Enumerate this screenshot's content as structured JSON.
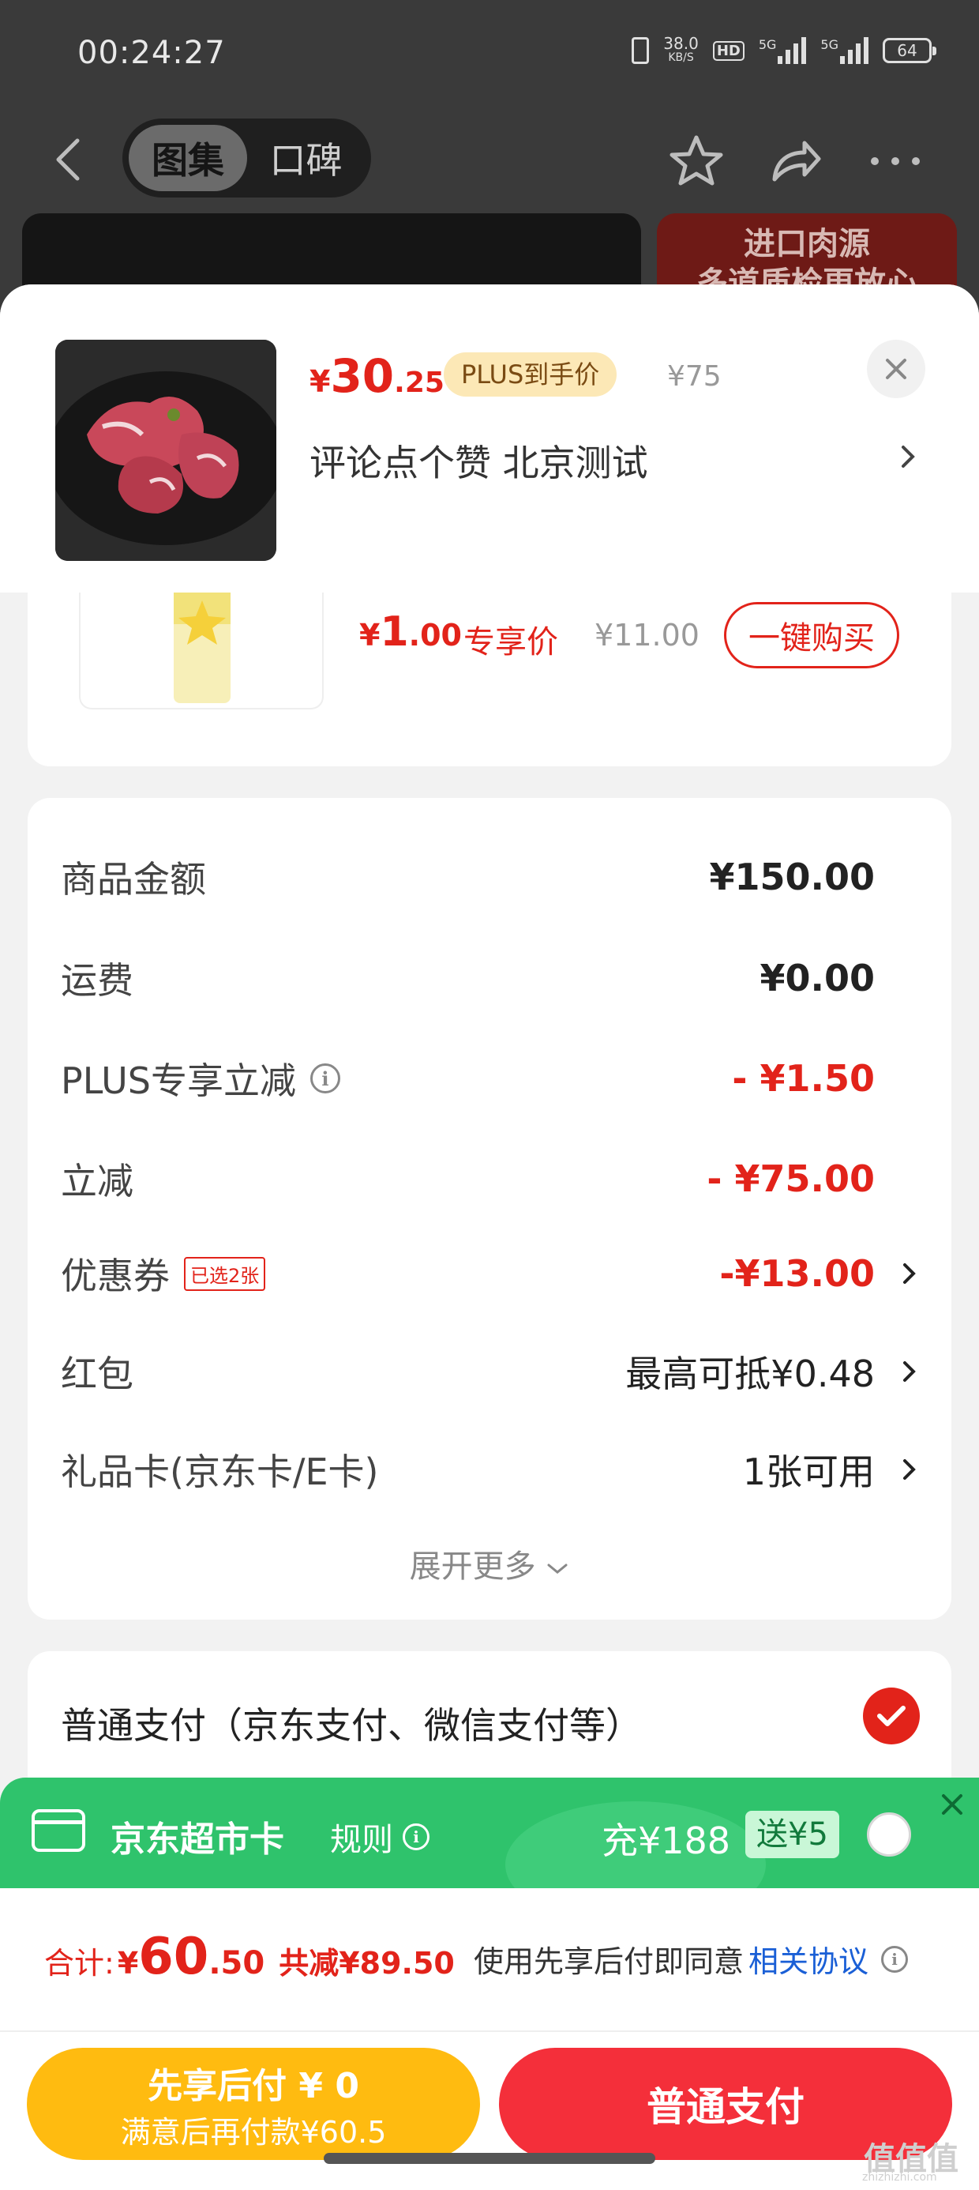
{
  "status_bar": {
    "time": "00:24:27",
    "net_speed": "38.0",
    "net_unit": "KB/S",
    "hd": "HD",
    "sig1_tag": "5G",
    "sig2_tag": "5G",
    "battery": "64"
  },
  "nav": {
    "tab_gallery": "图集",
    "tab_reviews": "口碑"
  },
  "hero": {
    "banner_text": "进口肉源\n多道质检更放心"
  },
  "product": {
    "price_currency": "¥",
    "price_int": "30",
    "price_dec": ".25",
    "plus_badge": "PLUS到手价",
    "original_price": "¥75",
    "title": "评论点个赞  北京测试"
  },
  "gift_item": {
    "price_currency": "¥",
    "price_int": "1",
    "price_dec": ".00",
    "tag": "专享价",
    "original_price": "¥11.00",
    "buy_label": "一键购买"
  },
  "summary": {
    "rows": [
      {
        "label": "商品金额",
        "value": "¥150.00"
      },
      {
        "label": "运费",
        "value": "¥0.00"
      },
      {
        "label": "PLUS专享立减",
        "value": "- ¥1.50"
      },
      {
        "label": "立减",
        "value": "- ¥75.00"
      },
      {
        "label": "优惠券",
        "badge": "已选2张",
        "value": "-¥13.00"
      },
      {
        "label": "红包",
        "value": "最高可抵¥0.48"
      },
      {
        "label": "礼品卡(京东卡/E卡)",
        "value": "1张可用"
      }
    ],
    "expand_label": "展开更多"
  },
  "payment": {
    "normal_label": "普通支付（京东支付、微信支付等）"
  },
  "promo": {
    "title": "京东超市卡",
    "rule_label": "规则",
    "charge": "充¥188",
    "gift": "送¥5"
  },
  "bottom": {
    "total_label": "合计:",
    "total_currency": "¥",
    "total_int": "60",
    "total_dec": ".50",
    "total_savings": "共减¥89.50",
    "agree_text": "使用先享后付即同意",
    "agree_link": "相关协议",
    "btn_later_main": "先享后付 ¥ 0",
    "btn_later_sub": "满意后再付款¥60.5",
    "btn_normal": "普通支付"
  },
  "watermark": {
    "text": "值值值",
    "sub": "zhizhizhi.com"
  },
  "colors": {
    "accent_red": "#e2231a",
    "promo_green": "#2fc36c",
    "later_yellow": "#ffbb10",
    "pay_red": "#f42f3a",
    "link_blue": "#1a5fd6"
  }
}
